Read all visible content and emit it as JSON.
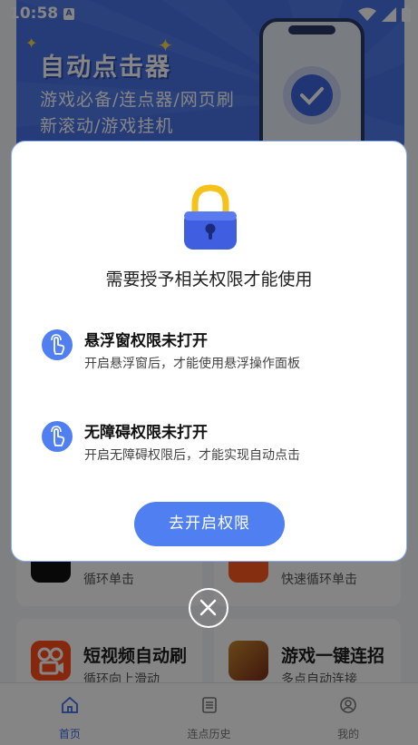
{
  "status_bar": {
    "time": "10:58",
    "notification_badge": "A"
  },
  "banner": {
    "title": "自动点击器",
    "subtitle_line1": "游戏必备/连点器/网页刷",
    "subtitle_line2": "新滚动/游戏挂机"
  },
  "cards": [
    {
      "desc": "循环单击",
      "icon": "tiktok-icon"
    },
    {
      "desc": "快速循环单击",
      "icon": "taobao-icon"
    },
    {
      "title": "短视频自动刷",
      "desc": "循环向上滑动",
      "icon": "kuaishou-icon"
    },
    {
      "title": "游戏一键连招",
      "desc": "多点自动连接",
      "icon": "game-hero-icon"
    }
  ],
  "nav": [
    {
      "label": "首页",
      "icon": "home-icon",
      "active": true
    },
    {
      "label": "连点历史",
      "icon": "list-icon",
      "active": false
    },
    {
      "label": "我的",
      "icon": "profile-icon",
      "active": false
    }
  ],
  "dialog": {
    "title": "需要授予相关权限才能使用",
    "permissions": [
      {
        "title": "悬浮窗权限未打开",
        "desc": "开启悬浮窗后，才能使用悬浮操作面板"
      },
      {
        "title": "无障碍权限未打开",
        "desc": "开启无障碍权限后，才能实现自动点击"
      }
    ],
    "button_label": "去开启权限"
  },
  "colors": {
    "accent": "#4f7ff0",
    "banner": "#4a74e8",
    "lock_body": "#3f5fe0",
    "lock_shackle": "#f5c21a"
  }
}
